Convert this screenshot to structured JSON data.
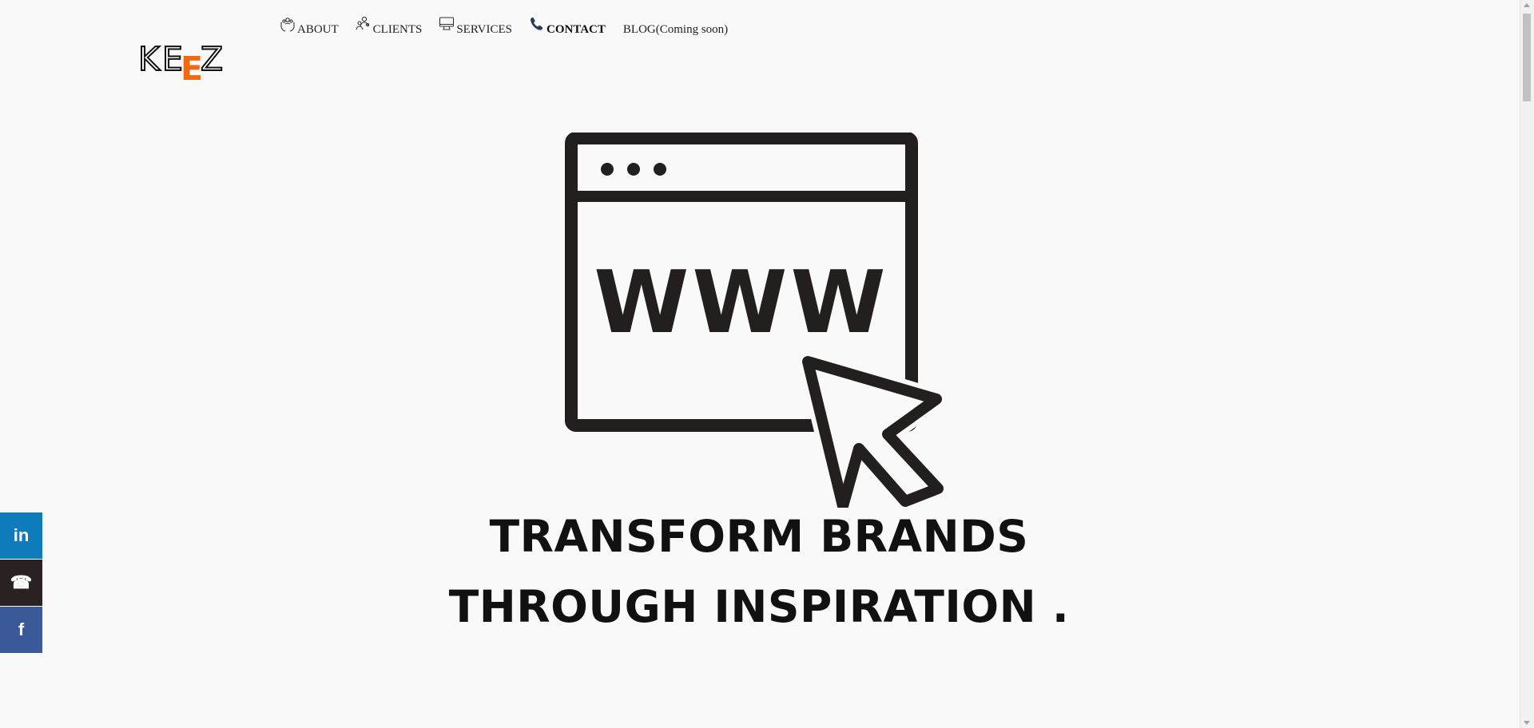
{
  "logo": {
    "letters": [
      "K",
      "E",
      "E",
      "Z"
    ],
    "accent_color": "#ef6a12"
  },
  "nav": {
    "items": [
      {
        "label": "ABOUT",
        "icon": "hands-team-icon"
      },
      {
        "label": "CLIENTS",
        "icon": "people-icon"
      },
      {
        "label": "SERVICES",
        "icon": "monitor-icon"
      },
      {
        "label": "CONTACT",
        "icon": "phone-icon"
      },
      {
        "label": "BLOG(Coming soon)"
      }
    ]
  },
  "hero": {
    "illustration_text": "WWW",
    "headline_line1": "TRANSFORM BRANDS",
    "headline_line2": "THROUGH INSPIRATION ."
  },
  "social": {
    "items": [
      {
        "glyph": "in",
        "icon": "linkedin-icon",
        "color": "#0e7bbb"
      },
      {
        "glyph": "☎",
        "icon": "phone-icon",
        "color": "#2a2222"
      },
      {
        "glyph": "f",
        "icon": "facebook-icon",
        "color": "#3b5998"
      }
    ]
  }
}
